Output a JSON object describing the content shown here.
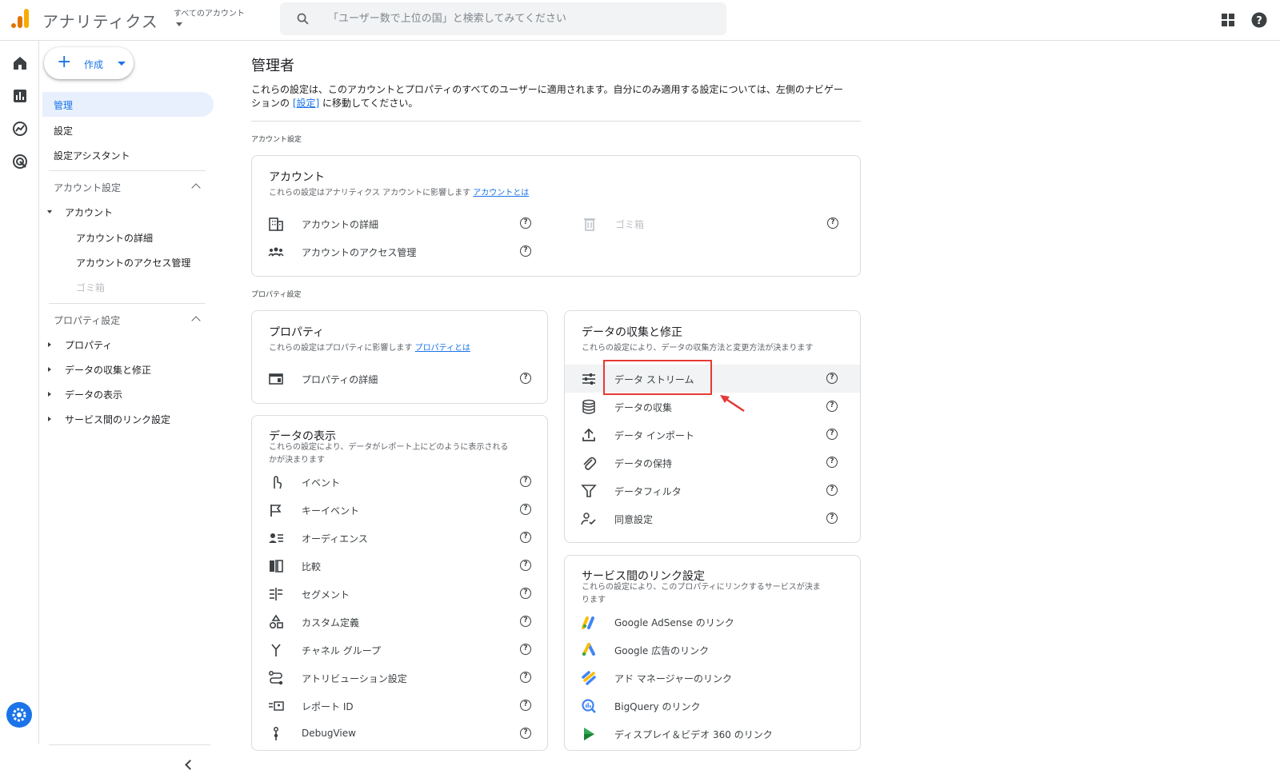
{
  "app": {
    "title": "アナリティクス",
    "account_picker_label": "すべてのアカウント"
  },
  "search": {
    "placeholder": "「ユーザー数で上位の国」と検索してみてください"
  },
  "nav": {
    "create_label": "作成",
    "items": [
      {
        "label": "管理",
        "active": true
      },
      {
        "label": "設定"
      },
      {
        "label": "設定アシスタント"
      }
    ],
    "account_section": {
      "label": "アカウント設定",
      "group": "アカウント",
      "children": [
        "アカウントの詳細",
        "アカウントのアクセス管理",
        "ゴミ箱"
      ]
    },
    "property_section": {
      "label": "プロパティ設定",
      "children": [
        "プロパティ",
        "データの収集と修正",
        "データの表示",
        "サービス間のリンク設定"
      ]
    }
  },
  "page": {
    "title": "管理者",
    "desc_line1": "これらの設定は、このアカウントとプロパティのすべてのユーザーに適用されます。自分にのみ適用する設定については、左側のナビゲー",
    "desc_line2_pre": "ションの",
    "desc_link": "[設定]",
    "desc_line2_post": "に移動してください。",
    "account_section_label": "アカウント設定",
    "property_section_label": "プロパティ設定"
  },
  "account_card": {
    "title": "アカウント",
    "sub": "これらの設定はアナリティクス アカウントに影響します",
    "sub_link": "アカウントとは",
    "rows": [
      "アカウントの詳細",
      "アカウントのアクセス管理"
    ],
    "trash": "ゴミ箱"
  },
  "property_card": {
    "title": "プロパティ",
    "sub": "これらの設定はプロパティに影響します",
    "sub_link": "プロパティとは",
    "rows": [
      "プロパティの詳細"
    ]
  },
  "display_card": {
    "title": "データの表示",
    "sub_line1": "これらの設定により、データがレポート上にどのように表示される",
    "sub_line2": "かが決まります",
    "rows": [
      "イベント",
      "キーイベント",
      "オーディエンス",
      "比較",
      "セグメント",
      "カスタム定義",
      "チャネル グループ",
      "アトリビューション設定",
      "レポート ID",
      "DebugView"
    ]
  },
  "collection_card": {
    "title": "データの収集と修正",
    "sub": "これらの設定により、データの収集方法と変更方法が決まります",
    "rows": [
      "データ ストリーム",
      "データの収集",
      "データ インポート",
      "データの保持",
      "データフィルタ",
      "同意設定"
    ]
  },
  "links_card": {
    "title": "サービス間のリンク設定",
    "sub_line1": "これらの設定により、このプロパティにリンクするサービスが決ま",
    "sub_line2": "ります",
    "rows": [
      "Google AdSense のリンク",
      "Google 広告のリンク",
      "アド マネージャーのリンク",
      "BigQuery のリンク",
      "ディスプレイ＆ビデオ 360 のリンク"
    ]
  },
  "colors": {
    "accent": "#1a73e8",
    "highlight": "#e53935"
  }
}
